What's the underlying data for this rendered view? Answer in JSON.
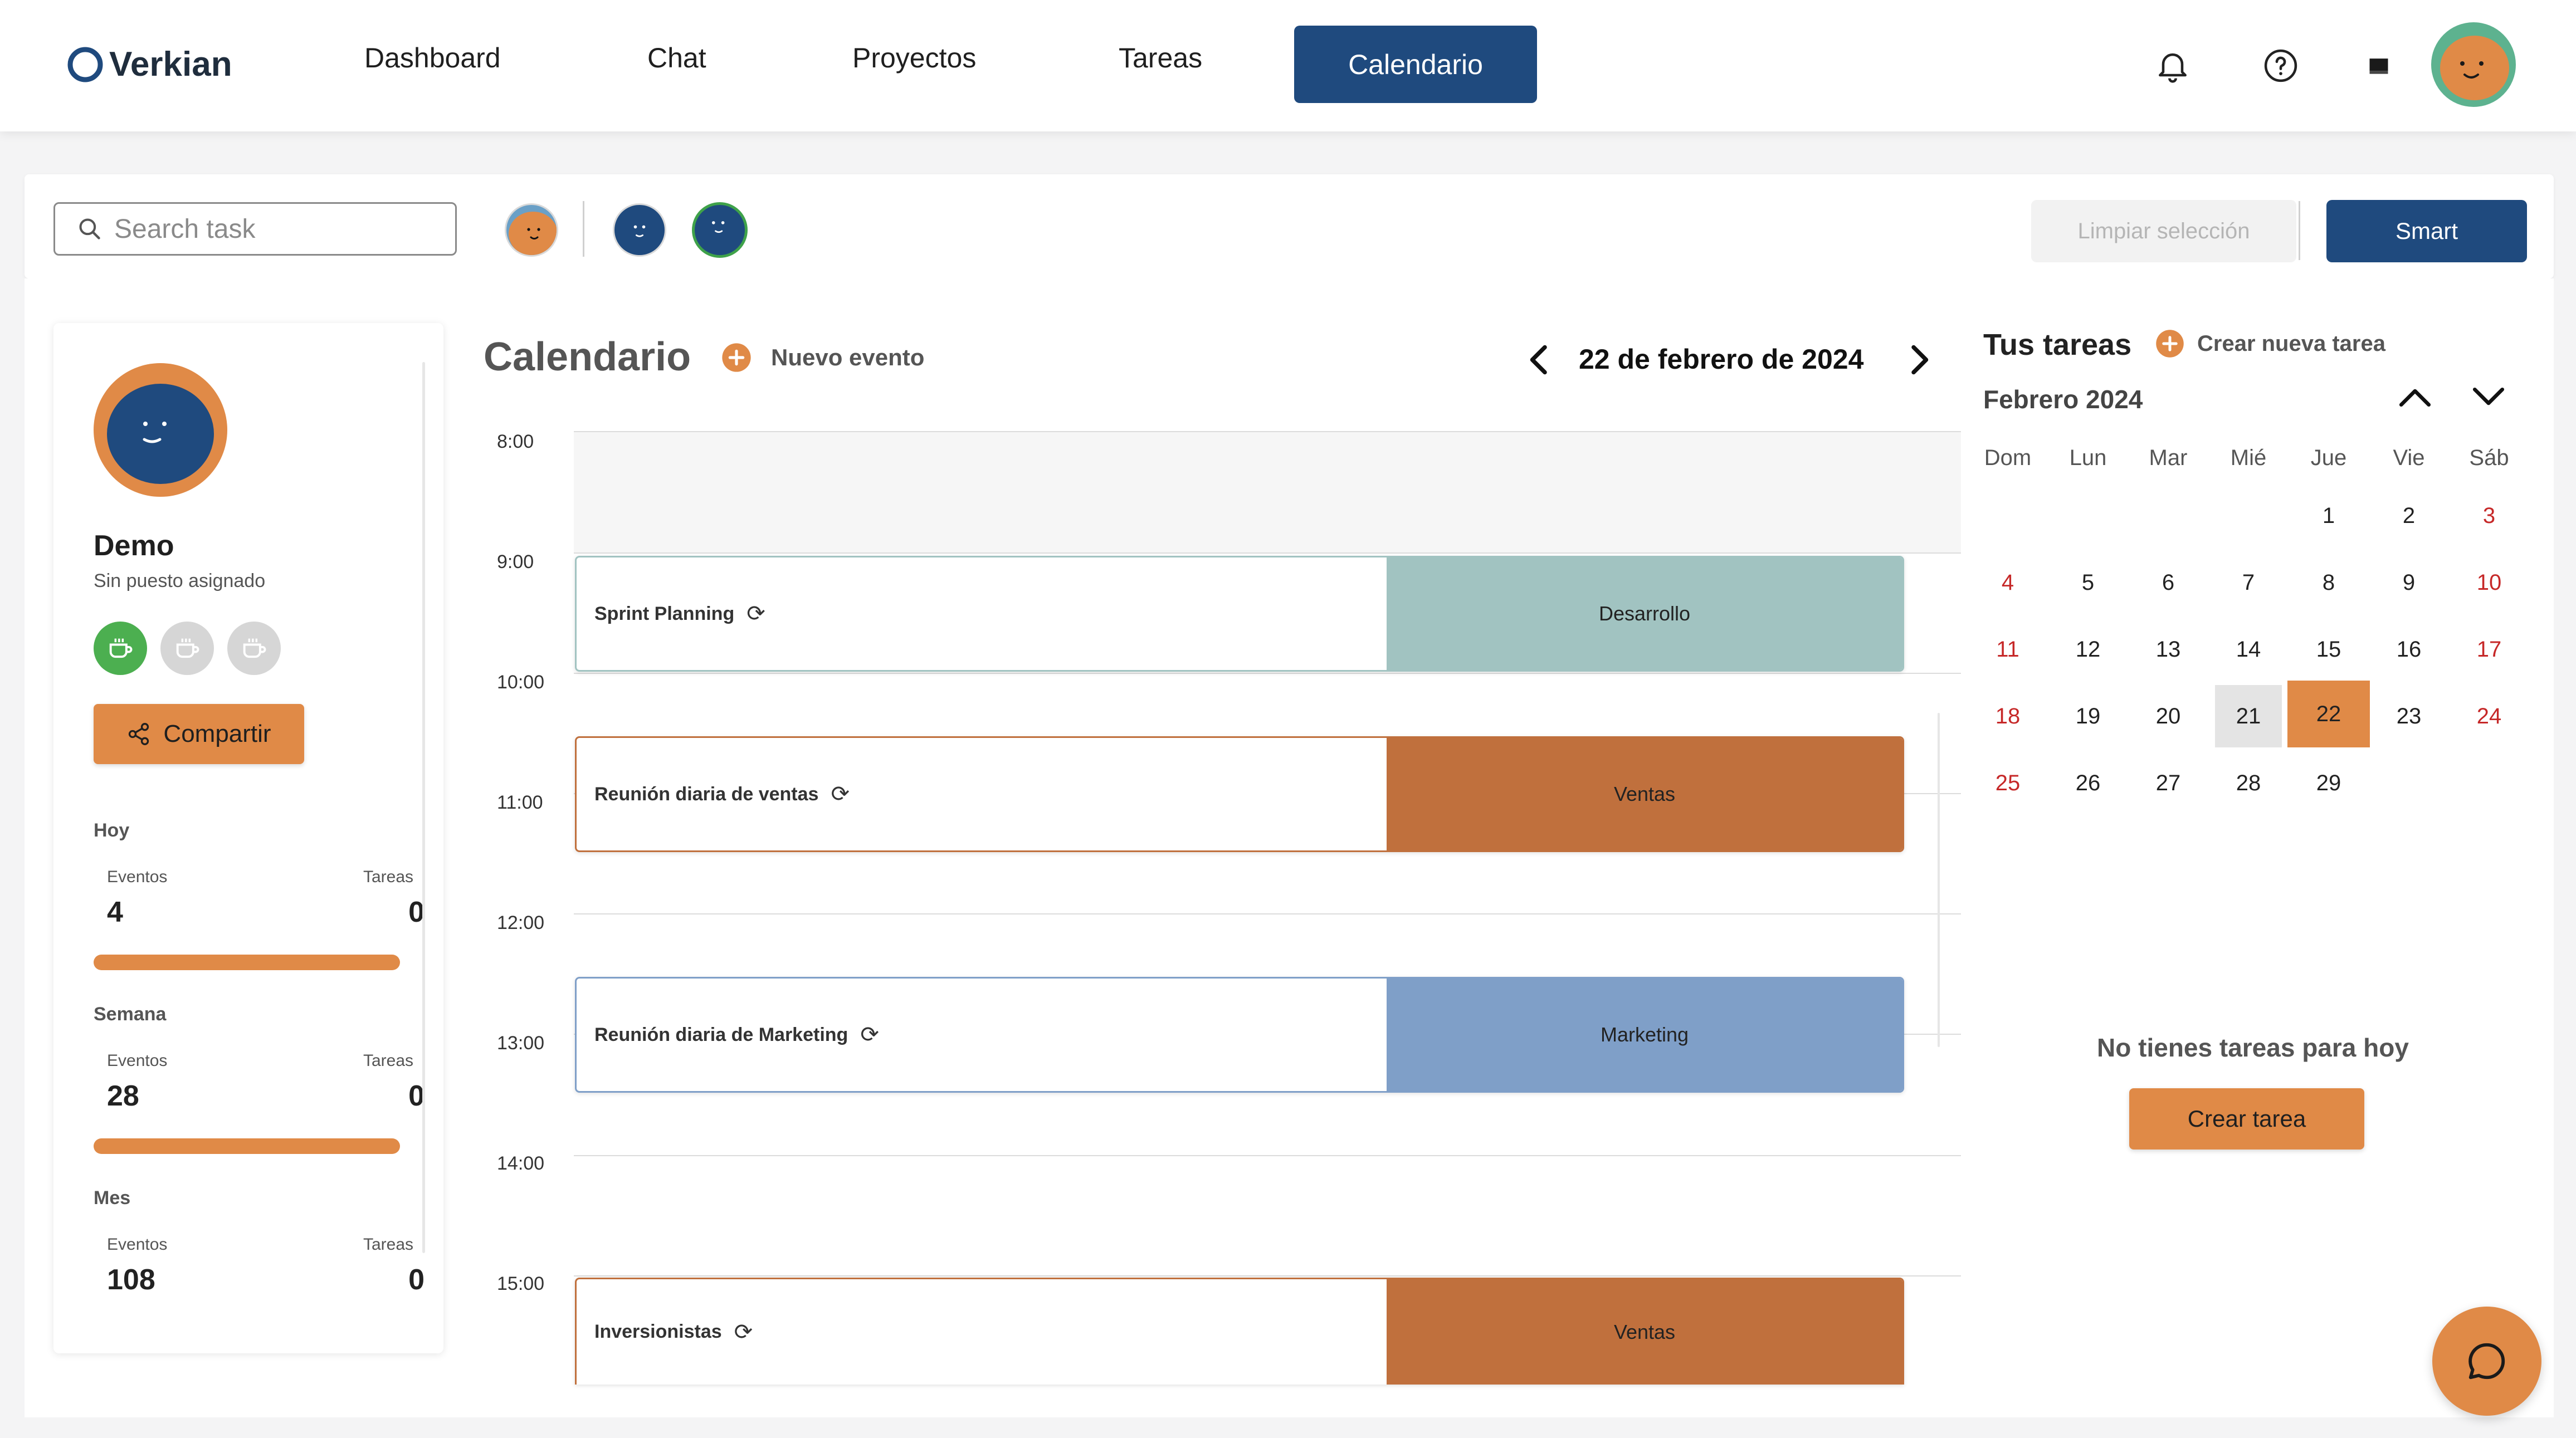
{
  "app": {
    "name": "Verkian"
  },
  "nav": {
    "items": [
      {
        "label": "Dashboard"
      },
      {
        "label": "Chat"
      },
      {
        "label": "Proyectos"
      },
      {
        "label": "Tareas"
      },
      {
        "label": "Calendario"
      }
    ],
    "active": "Calendario"
  },
  "icons": {
    "bell": "bell-icon",
    "help": "help-icon",
    "flag": "flag-icon",
    "chat": "chat-bubble-icon"
  },
  "colors": {
    "primary": "#1f4a7e",
    "accent": "#e08a47",
    "desarrollo": "#a1c3c1",
    "ventas": "#c0703d",
    "marketing": "#7f9fc8",
    "weekend": "#c62828"
  },
  "filter": {
    "search_placeholder": "Search task",
    "clear_label": "Limpiar selección",
    "smart_label": "Smart"
  },
  "profile": {
    "name": "Demo",
    "position": "Sin puesto asignado",
    "share_label": "Compartir",
    "stats": [
      {
        "period": "Hoy",
        "events_label": "Eventos",
        "tasks_label": "Tareas",
        "events": "4",
        "tasks": "0"
      },
      {
        "period": "Semana",
        "events_label": "Eventos",
        "tasks_label": "Tareas",
        "events": "28",
        "tasks": "0"
      },
      {
        "period": "Mes",
        "events_label": "Eventos",
        "tasks_label": "Tareas",
        "events": "108",
        "tasks": "0"
      }
    ]
  },
  "calendar": {
    "title": "Calendario",
    "new_event_label": "Nuevo evento",
    "current_date": "22 de febrero de 2024",
    "hours": [
      "8:00",
      "9:00",
      "10:00",
      "11:00",
      "12:00",
      "13:00",
      "14:00",
      "15:00"
    ],
    "events": [
      {
        "title": "Sprint Planning",
        "category": "Desarrollo"
      },
      {
        "title": "Reunión diaria de ventas",
        "category": "Ventas"
      },
      {
        "title": "Reunión diaria de Marketing",
        "category": "Marketing"
      },
      {
        "title": "Inversionistas",
        "category": "Ventas"
      }
    ]
  },
  "tasks": {
    "title": "Tus tareas",
    "create_new_label": "Crear nueva tarea",
    "month_label": "Febrero 2024",
    "weekdays": [
      "Dom",
      "Lun",
      "Mar",
      "Mié",
      "Jue",
      "Vie",
      "Sáb"
    ],
    "days": [
      "1",
      "2",
      "3",
      "4",
      "5",
      "6",
      "7",
      "8",
      "9",
      "10",
      "11",
      "12",
      "13",
      "14",
      "15",
      "16",
      "17",
      "18",
      "19",
      "20",
      "21",
      "22",
      "23",
      "24",
      "25",
      "26",
      "27",
      "28",
      "29"
    ],
    "selected_day": "22",
    "today_day": "21",
    "empty_message": "No tienes tareas para hoy",
    "create_button_label": "Crear tarea"
  }
}
